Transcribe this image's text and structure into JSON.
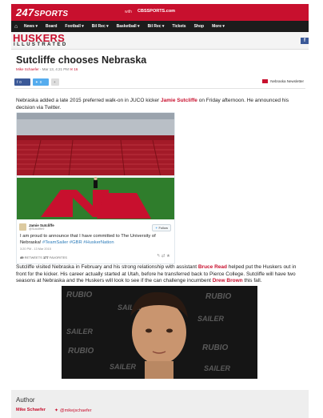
{
  "header": {
    "logo_num": "247",
    "logo_word": "SPORTS",
    "with_label": "with",
    "partner": "CBSSPORTS.com"
  },
  "nav": {
    "home_icon": "home-icon",
    "items": [
      "News",
      "Board",
      "Football",
      "Bil Rec",
      "Basketball",
      "Bil Rec",
      "Tickets",
      "Shop",
      "More"
    ]
  },
  "masthead": {
    "title": "HUSKERS",
    "subtitle": "ILLUSTRATED",
    "social": "f"
  },
  "article": {
    "title": "Sutcliffe chooses Nebraska",
    "author": "Mike Schaefer",
    "date": " - Mar 13, 4:21 PM",
    "comments": "16",
    "share": {
      "fb_count": "0",
      "tw_count": "0",
      "plus": "+"
    },
    "newsletter": "Nebraska Newsletter",
    "para1_a": "Nebraska added a late 2015 preferred walk-on in JUCO kicker ",
    "para1_name": "Jamie Sutcliffe",
    "para1_b": " on Friday afternoon. He announced his decision via Twitter.",
    "para2_a": "Sutcliffe visited Nebraska in February and his strong relationship with assistant ",
    "para2_name1": "Bruce Read",
    "para2_b": " helped put the Huskers out in front for the kicker. His career actually started at Utah, before he transferred back to Pierce College. Sutcliffe will have two seasons at Nebraska and the Huskers will look to see if the can challenge incumbent ",
    "para2_name2": "Drew Brown",
    "para2_c": " this fall."
  },
  "tweet": {
    "name": "Jamie Sutcliffe",
    "handle": "@Sutcliffe9",
    "follow": "Follow",
    "text_a": "I am proud to announce that I have committed to The University of Nebraska! ",
    "tags": "#TeamSailer #GBR #HuskerNation",
    "time": "3:20 PM - 13 Mar 2015",
    "retweets": "49",
    "retweets_label": "RETWEETS",
    "favorites": "177",
    "favorites_label": "FAVORITES",
    "actions": "↰  ⇄  ★"
  },
  "author_box": {
    "heading": "Author",
    "name": "Mike Schaefer",
    "twitter": "@mikejschaefer"
  },
  "colors": {
    "brand_red": "#c8102e",
    "nav_dark": "#1c1c1c",
    "twitter_blue": "#55acee",
    "facebook_blue": "#3b5998"
  }
}
